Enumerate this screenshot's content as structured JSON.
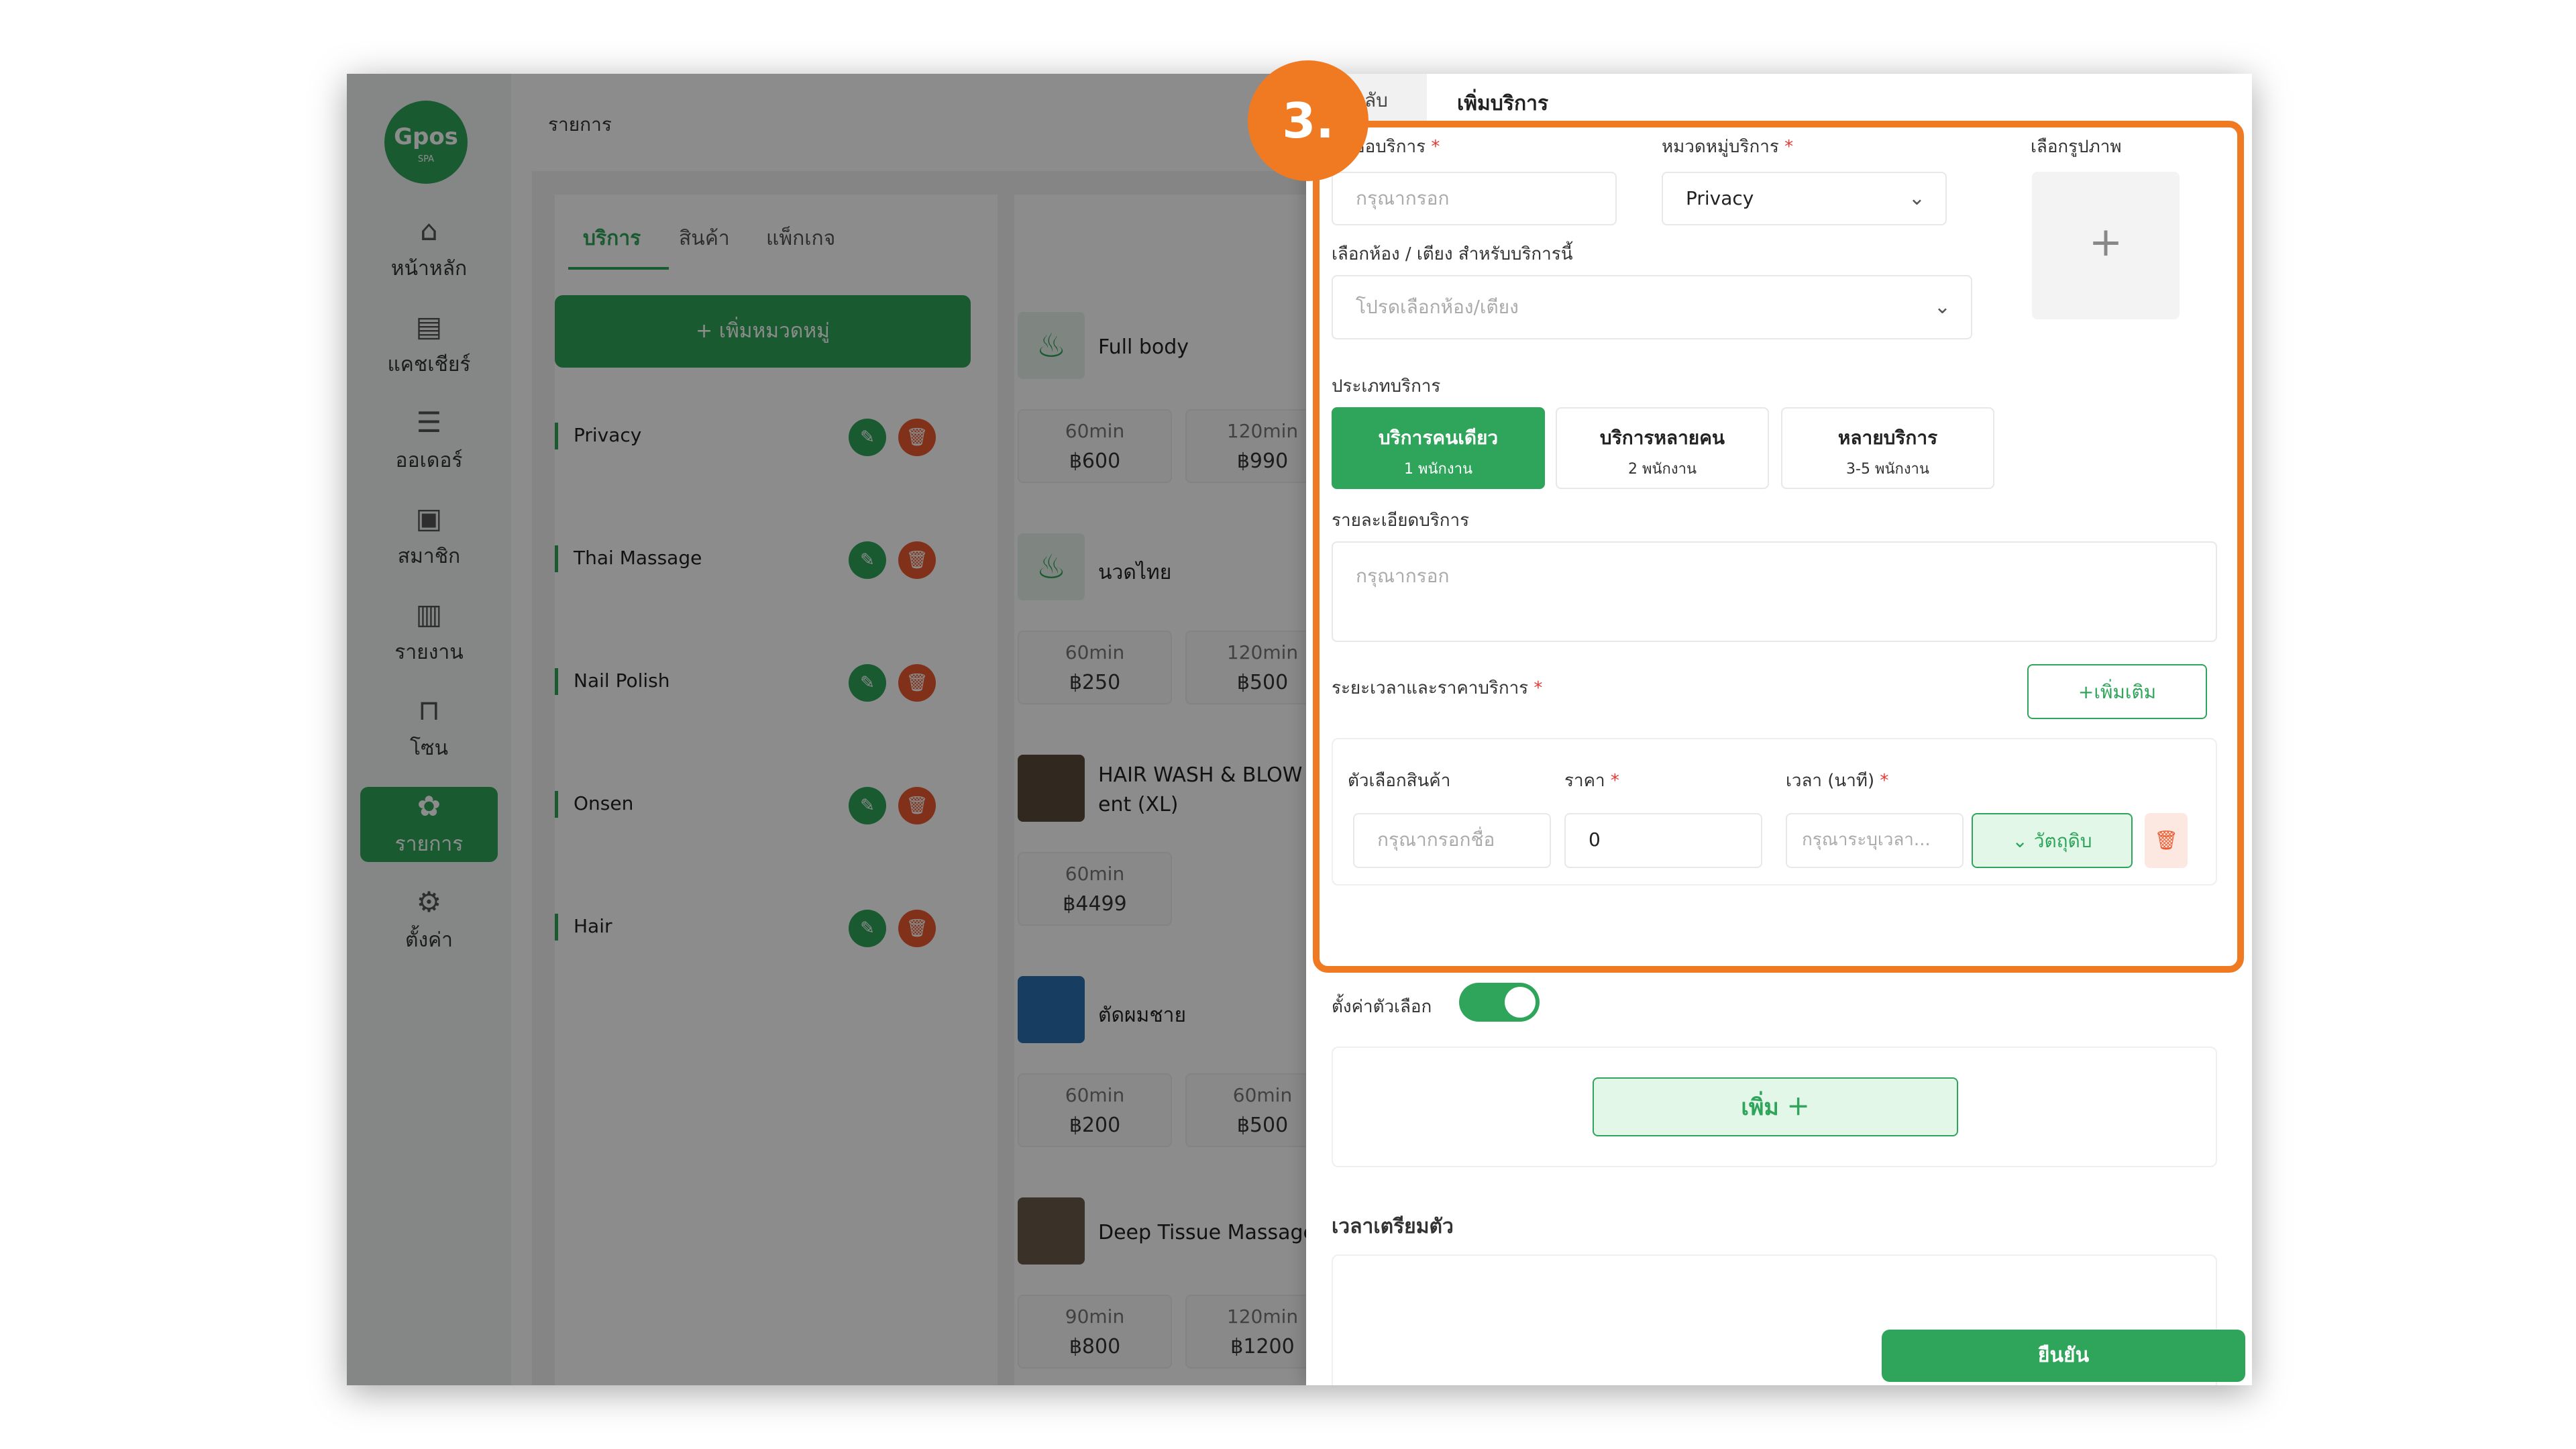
{
  "app": {
    "logo_text": "Gpos",
    "logo_sub": "SPA",
    "page_title": "รายการ"
  },
  "sidebar": {
    "items": [
      {
        "icon": "home-icon",
        "label": "หน้าหลัก"
      },
      {
        "icon": "cashier-icon",
        "label": "แคชเชียร์"
      },
      {
        "icon": "order-icon",
        "label": "ออเดอร์"
      },
      {
        "icon": "member-icon",
        "label": "สมาชิก"
      },
      {
        "icon": "report-icon",
        "label": "รายงาน"
      },
      {
        "icon": "zone-icon",
        "label": "โซน"
      },
      {
        "icon": "list-icon",
        "label": "รายการ"
      },
      {
        "icon": "gear-icon",
        "label": "ตั้งค่า"
      }
    ],
    "active_index": 6
  },
  "tabs": [
    "บริการ",
    "สินค้า",
    "แพ็กเกจ"
  ],
  "add_category_label": "+  เพิ่มหมวดหมู่",
  "categories": [
    "Privacy",
    "Thai Massage",
    "Nail Polish",
    "Onsen",
    "Hair"
  ],
  "services": [
    {
      "name": "Full body",
      "prices": [
        {
          "duration": "60min",
          "price": "฿600"
        },
        {
          "duration": "120min",
          "price": "฿990"
        }
      ]
    },
    {
      "name": "นวดไทย",
      "prices": [
        {
          "duration": "60min",
          "price": "฿250"
        },
        {
          "duration": "120min",
          "price": "฿500"
        }
      ]
    },
    {
      "name": "HAIR WASH & BLOW DRY ent (XL)",
      "name_line1": "HAIR WASH & BLOW D",
      "name_line2": "ent (XL)",
      "prices": [
        {
          "duration": "60min",
          "price": "฿4499"
        }
      ]
    },
    {
      "name": "ตัดผมชาย",
      "prices": [
        {
          "duration": "60min",
          "price": "฿200"
        },
        {
          "duration": "60min",
          "price": "฿500"
        }
      ]
    },
    {
      "name": "Deep Tissue Massage",
      "prices": [
        {
          "duration": "90min",
          "price": "฿800"
        },
        {
          "duration": "120min",
          "price": "฿1200"
        }
      ]
    }
  ],
  "drawer": {
    "back_label": "กลับ",
    "title": "เพิ่มบริการ",
    "service_name_label": "ชื่อบริการ",
    "service_name_placeholder": "กรุณากรอก",
    "category_label": "หมวดหมู่บริการ",
    "category_value": "Privacy",
    "image_label": "เลือกรูปภาพ",
    "image_plus": "+",
    "room_label": "เลือกห้อง / เตียง สำหรับบริการนี้",
    "room_placeholder": "โปรดเลือกห้อง/เตียง",
    "service_type_label": "ประเภทบริการ",
    "service_types": [
      {
        "title": "บริการคนเดียว",
        "sub": "1 พนักงาน"
      },
      {
        "title": "บริการหลายคน",
        "sub": "2 พนักงาน"
      },
      {
        "title": "หลายบริการ",
        "sub": "3-5 พนักงาน"
      }
    ],
    "detail_label": "รายละเอียดบริการ",
    "detail_placeholder": "กรุณากรอก",
    "duration_price_label": "ระยะเวลาและราคาบริการ",
    "add_more_label": "+เพิ่มเติม",
    "option_label": "ตัวเลือกสินค้า",
    "option_placeholder": "กรุณากรอกชื่อ",
    "price_label": "ราคา",
    "price_value": "0",
    "time_label": "เวลา (นาที)",
    "time_placeholder": "กรุณาระบุเวลา...",
    "ingredient_label": "วัตถุดิบ",
    "option_setting_label": "ตั้งค่าตัวเลือก",
    "add_button_label": "เพิ่ม",
    "prep_time_label": "เวลาเตรียมตัว",
    "confirm_label": "ยืนยัน"
  },
  "annotation": {
    "step_label": "3.",
    "color": "#f07a22"
  },
  "colors": {
    "brand_green": "#2ea55a",
    "delete_orange": "#ec5a2e"
  }
}
